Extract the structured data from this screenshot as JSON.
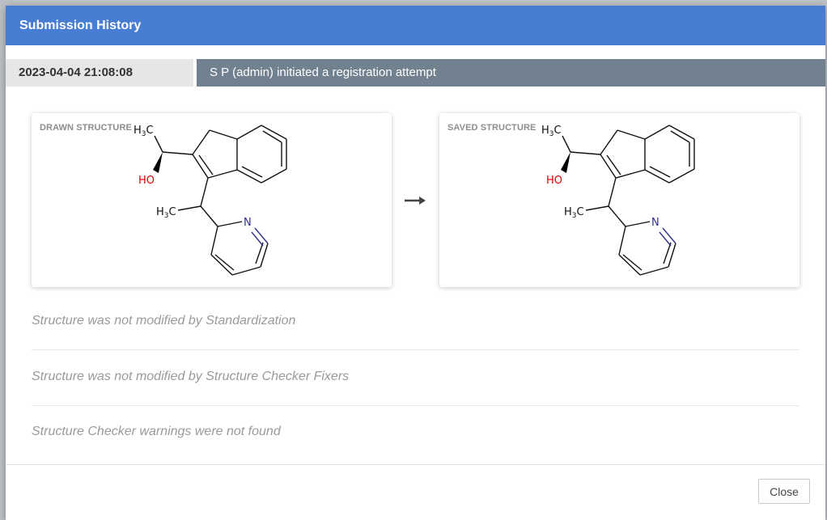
{
  "dialog": {
    "title": "Submission History",
    "close_label": "Close"
  },
  "history": {
    "timestamp": "2023-04-04 21:08:08",
    "message": "S P (admin) initiated a registration attempt"
  },
  "structures": {
    "drawn_label": "DRAWN STRUCTURE",
    "saved_label": "SAVED STRUCTURE",
    "atoms": {
      "methyl_top": "H",
      "methyl_side": "H",
      "hydroxyl": "HO",
      "nitrogen": "N",
      "subscript": "3",
      "carbon": "C"
    }
  },
  "messages": [
    "Structure was not modified by Standardization",
    "Structure was not modified by Structure Checker Fixers",
    "Structure Checker warnings were not found"
  ],
  "icons": {
    "arrow": "arrow-right-icon"
  },
  "colors": {
    "header": "#477ed4",
    "history_bar": "#718190",
    "oxygen": "#e00000",
    "nitrogen": "#303090"
  }
}
